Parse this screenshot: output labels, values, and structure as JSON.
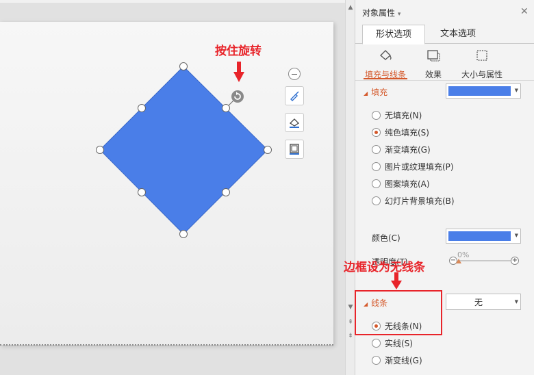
{
  "annotations": {
    "rotate_hint": "按住旋转",
    "border_hint": "边框设为无线条"
  },
  "panel": {
    "title": "对象属性",
    "title_arrow": "▾",
    "close": "✕",
    "tabs": [
      {
        "label": "形状选项",
        "active": true
      },
      {
        "label": "文本选项",
        "active": false
      }
    ],
    "subtabs": [
      {
        "label": "填充与线条",
        "icon": "paint-bucket-icon",
        "active": true
      },
      {
        "label": "效果",
        "icon": "effects-icon",
        "active": false
      },
      {
        "label": "大小与属性",
        "icon": "size-properties-icon",
        "active": false
      }
    ],
    "fill_section": {
      "title": "填充",
      "options": [
        {
          "label": "无填充(N)",
          "checked": false
        },
        {
          "label": "纯色填充(S)",
          "checked": true
        },
        {
          "label": "渐变填充(G)",
          "checked": false
        },
        {
          "label": "图片或纹理填充(P)",
          "checked": false
        },
        {
          "label": "图案填充(A)",
          "checked": false
        },
        {
          "label": "幻灯片背景填充(B)",
          "checked": false
        }
      ],
      "color_label": "颜色(C)",
      "transparency_label": "透明度(T)",
      "transparency_value": "0%",
      "transparency_fraction": 0,
      "color": "#4a7ee8"
    },
    "line_section": {
      "title": "线条",
      "value": "无",
      "options": [
        {
          "label": "无线条(N)",
          "checked": true
        },
        {
          "label": "实线(S)",
          "checked": false
        },
        {
          "label": "渐变线(G)",
          "checked": false
        }
      ]
    }
  },
  "colors": {
    "accent": "#d4582a",
    "shape_fill": "#4a7ee8",
    "annotation_red": "#e8242a"
  }
}
